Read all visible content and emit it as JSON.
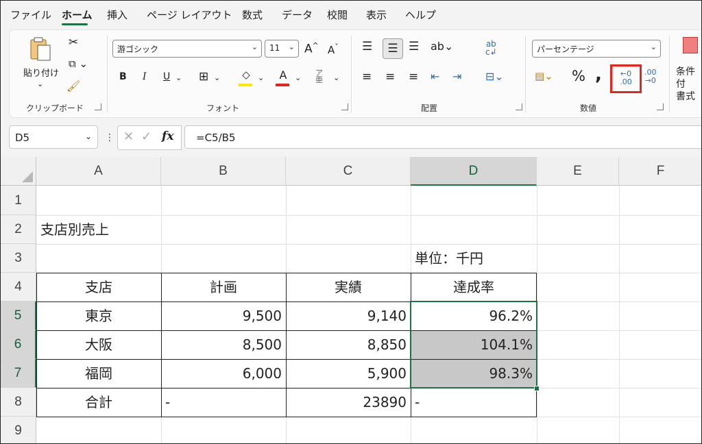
{
  "menu": [
    "ファイル",
    "ホーム",
    "挿入",
    "ページ レイアウト",
    "数式",
    "データ",
    "校閲",
    "表示",
    "ヘルプ"
  ],
  "ribbon": {
    "clipboard": {
      "paste": "貼り付け",
      "label": "クリップボード"
    },
    "font": {
      "name": "游ゴシック",
      "size": "11",
      "grow": "A",
      "shrink": "A",
      "bold": "B",
      "italic": "I",
      "underline": "U",
      "fontcolor": "A",
      "label": "フォント"
    },
    "alignment": {
      "label": "配置"
    },
    "number": {
      "format": "パーセンテージ",
      "percent": "%",
      "comma": ",",
      "inc_top": "←0",
      "inc_bottom": ".00",
      "dec_top": ".00",
      "dec_bottom": "→0",
      "label": "数値"
    },
    "styles": {
      "cond_line1": "条件付",
      "cond_line2": "書式"
    }
  },
  "formula_bar": {
    "cell": "D5",
    "formula": "=C5/B5",
    "fx": "fx"
  },
  "columns": [
    "A",
    "B",
    "C",
    "D",
    "E",
    "F"
  ],
  "rows": [
    "1",
    "2",
    "3",
    "4",
    "5",
    "6",
    "7",
    "8",
    "9"
  ],
  "sheet": {
    "title": "支店別売上",
    "unit": "単位：千円",
    "headers": [
      "支店",
      "計画",
      "実績",
      "達成率"
    ],
    "data": [
      [
        "東京",
        "9,500",
        "9,140",
        "96.2%"
      ],
      [
        "大阪",
        "8,500",
        "8,850",
        "104.1%"
      ],
      [
        "福岡",
        "6,000",
        "5,900",
        "98.3%"
      ]
    ],
    "total": [
      "合計",
      "-",
      "23890",
      "-"
    ]
  },
  "colors": {
    "accent": "#1a7343",
    "highlight": "#e8231b",
    "shade": "#c8c8c8"
  }
}
